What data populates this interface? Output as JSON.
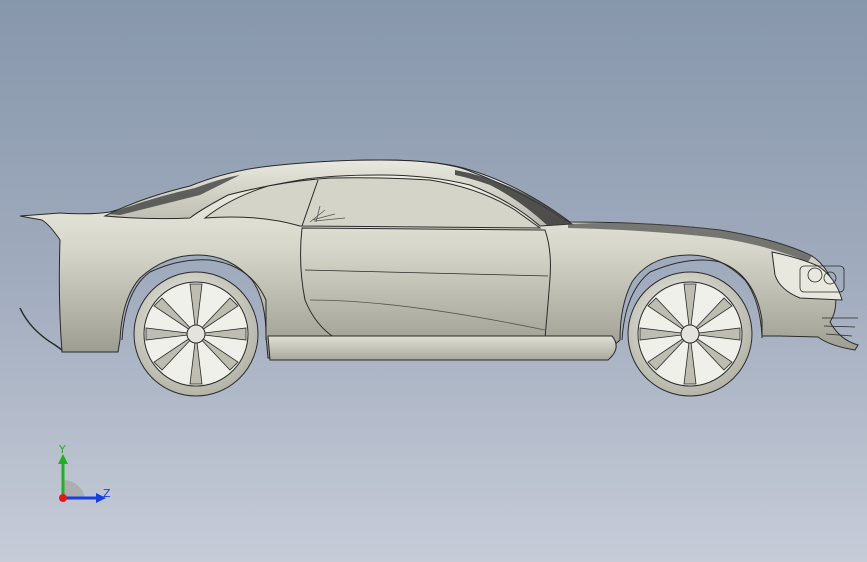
{
  "viewport": {
    "background_top": "#8797ab",
    "background_bottom": "#c7ccd8"
  },
  "model": {
    "name": "sports-car-side-view",
    "body_color": "#d8d8cc",
    "edge_color": "#2a2a2a",
    "glass_color": "#3a3a3a"
  },
  "triad": {
    "y_label": "Y",
    "z_label": "Z",
    "y_color": "#1db31d",
    "z_color": "#1a3fe0",
    "x_color": "#e01a1a"
  }
}
